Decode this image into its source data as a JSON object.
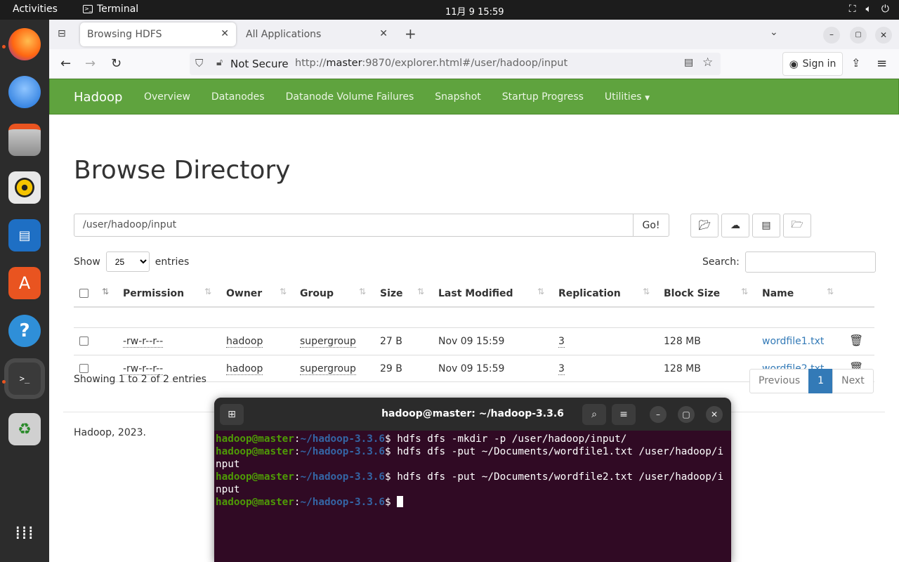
{
  "topbar": {
    "activities": "Activities",
    "app_name": "Terminal",
    "clock": "11月 9  15:59"
  },
  "browser": {
    "tabs": [
      {
        "label": "Browsing HDFS"
      },
      {
        "label": "All Applications"
      }
    ],
    "security_label": "Not Secure",
    "url_prefix": "http://",
    "url_host": "master",
    "url_rest": ":9870/explorer.html#/user/hadoop/input",
    "signin": "Sign in"
  },
  "hadoop_nav": {
    "brand": "Hadoop",
    "links": [
      "Overview",
      "Datanodes",
      "Datanode Volume Failures",
      "Snapshot",
      "Startup Progress",
      "Utilities"
    ]
  },
  "page": {
    "title": "Browse Directory",
    "path": "/user/hadoop/input",
    "go": "Go!",
    "show_label": "Show",
    "show_value": "25",
    "entries_label": "entries",
    "search_label": "Search:"
  },
  "table": {
    "headers": [
      "Permission",
      "Owner",
      "Group",
      "Size",
      "Last Modified",
      "Replication",
      "Block Size",
      "Name"
    ],
    "rows": [
      {
        "permission": "-rw-r--r--",
        "owner": "hadoop",
        "group": "supergroup",
        "size": "27 B",
        "modified": "Nov 09 15:59",
        "replication": "3",
        "block_size": "128 MB",
        "name": "wordfile1.txt"
      },
      {
        "permission": "-rw-r--r--",
        "owner": "hadoop",
        "group": "supergroup",
        "size": "29 B",
        "modified": "Nov 09 15:59",
        "replication": "3",
        "block_size": "128 MB",
        "name": "wordfile2.txt"
      }
    ]
  },
  "pagination": {
    "info": "Showing 1 to 2 of 2 entries",
    "previous": "Previous",
    "current": "1",
    "next": "Next"
  },
  "footer": "Hadoop, 2023.",
  "terminal": {
    "title": "hadoop@master: ~/hadoop-3.3.6",
    "user_host": "hadoop@master",
    "path": "~/hadoop-3.3.6",
    "lines": [
      "$ hdfs dfs -mkdir -p /user/hadoop/input/",
      "$ hdfs dfs -put ~/Documents/wordfile1.txt /user/hadoop/input",
      "$ hdfs dfs -put ~/Documents/wordfile2.txt /user/hadoop/input",
      "$ "
    ]
  },
  "colors": {
    "hadoop_green": "#5fa33e",
    "link_blue": "#337ab7",
    "terminal_bg": "#300a24",
    "prompt_green": "#4e9a06",
    "prompt_blue": "#3465a4"
  }
}
